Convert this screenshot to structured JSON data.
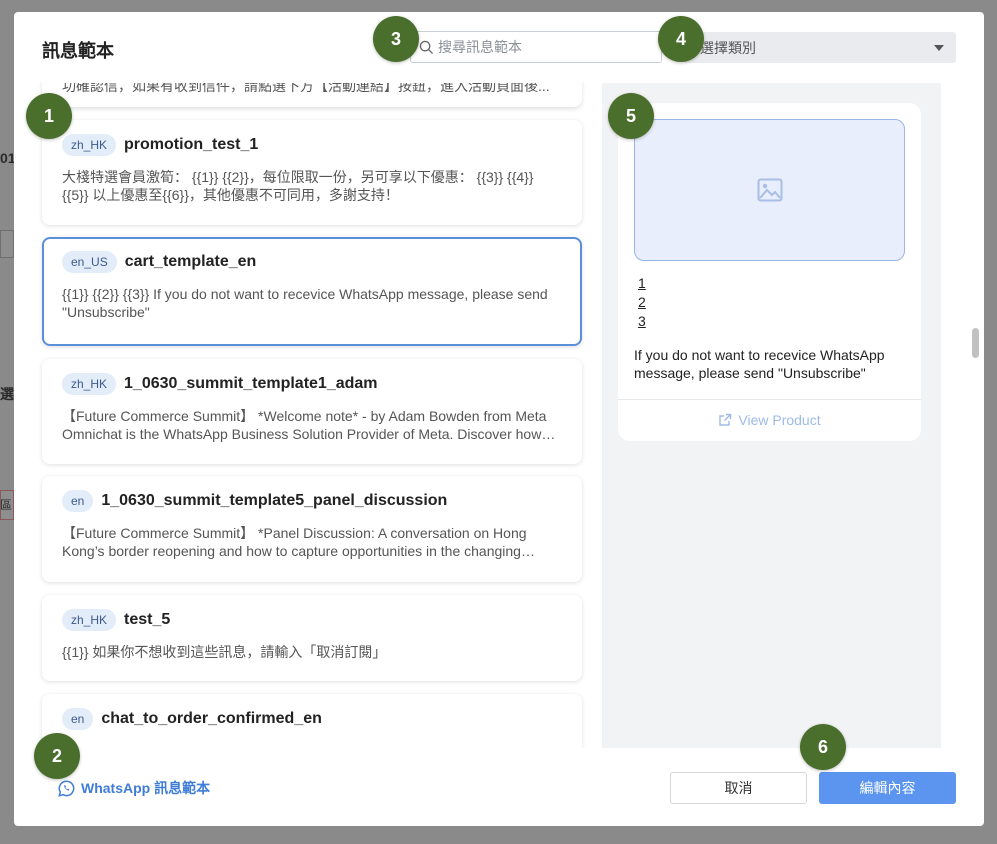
{
  "background": {
    "fragments": [
      "01",
      "選",
      "區"
    ]
  },
  "modal": {
    "title": "訊息範本",
    "search": {
      "placeholder": "搜尋訊息範本",
      "icon": "search-icon"
    },
    "category": {
      "selected": "選擇類別",
      "icon": "chevron-down-icon"
    },
    "cut_card_text": "功確認信，如果有收到信件，請點選下方【活動連結】按鈕，進入活動頁面後...",
    "templates": [
      {
        "lang": "zh_HK",
        "name": "promotion_test_1",
        "body": "大棧特選會員激筍： {{1}} {{2}}，每位限取一份，另可享以下優惠： {{3}} {{4}} {{5}} 以上優惠至{{6}}，其他優惠不可同用，多謝支持！",
        "selected": false
      },
      {
        "lang": "en_US",
        "name": "cart_template_en",
        "body": "{{1}} {{2}} {{3}} If you do not want to recevice WhatsApp message, please send \"Unsubscribe\"",
        "selected": true
      },
      {
        "lang": "zh_HK",
        "name": "1_0630_summit_template1_adam",
        "body": "【Future Commerce Summit】 *Welcome note* - by Adam Bowden from Meta Omnichat is the WhatsApp Business Solution Provider of Meta. Discover how businesses can...",
        "selected": false
      },
      {
        "lang": "en",
        "name": "1_0630_summit_template5_panel_discussion",
        "body": "【Future Commerce Summit】 *Panel Discussion: A conversation on Hong Kong’s border reopening and how to capture opportunities in the changing market...",
        "selected": false
      },
      {
        "lang": "zh_HK",
        "name": "test_5",
        "body": "{{1}} 如果你不想收到這些訊息，請輸入「取消訂閱」",
        "selected": false
      },
      {
        "lang": "en",
        "name": "chat_to_order_confirmed_en",
        "body": "",
        "selected": false
      }
    ],
    "preview": {
      "image_icon": "image-icon",
      "numbers": [
        "1",
        "2",
        "3"
      ],
      "text": "If you do not want to recevice WhatsApp message, please send \"Unsubscribe\"",
      "view_product": "View Product",
      "view_product_icon": "external-link-icon"
    },
    "footer": {
      "whatsapp_link": "WhatsApp 訊息範本",
      "whatsapp_icon": "whatsapp-icon",
      "cancel": "取消",
      "edit": "編輯內容"
    }
  },
  "markers": [
    "1",
    "2",
    "3",
    "4",
    "5",
    "6"
  ],
  "colors": {
    "primary": "#5b95ef",
    "marker": "#4a6e2c",
    "selected_border": "#5b8fd9",
    "badge_bg": "#e3ecf9"
  }
}
